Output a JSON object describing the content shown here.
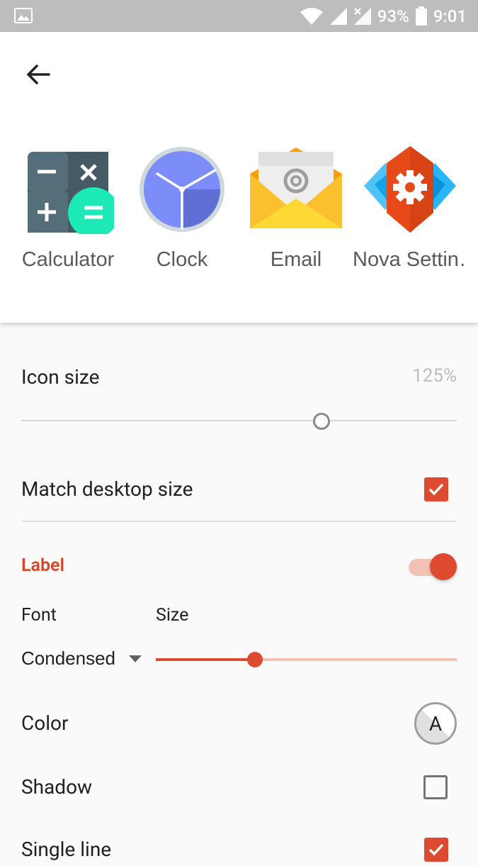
{
  "status_bar": {
    "battery": "93%",
    "time": "9:01"
  },
  "preview": {
    "apps": [
      {
        "label": "Calculator",
        "icon": "calculator-icon"
      },
      {
        "label": "Clock",
        "icon": "clock-icon"
      },
      {
        "label": "Email",
        "icon": "email-icon"
      },
      {
        "label": "Nova Settin…",
        "icon": "nova-settings-icon"
      }
    ]
  },
  "settings": {
    "icon_size": {
      "title": "Icon size",
      "value": "125%",
      "slider_fraction": 0.69
    },
    "match_desktop": {
      "title": "Match desktop size",
      "checked": true
    },
    "label_section": {
      "title": "Label",
      "enabled": true
    },
    "font": {
      "title": "Font",
      "value": "Condensed"
    },
    "size": {
      "title": "Size",
      "slider_fraction": 0.33
    },
    "color": {
      "title": "Color",
      "preview_letter": "A"
    },
    "shadow": {
      "title": "Shadow",
      "checked": false
    },
    "single_line": {
      "title": "Single line",
      "checked": true
    }
  },
  "colors": {
    "accent": "#dc4b2f",
    "accent_light": "#f2c1b4",
    "status_bar": "#bdbdbd"
  }
}
